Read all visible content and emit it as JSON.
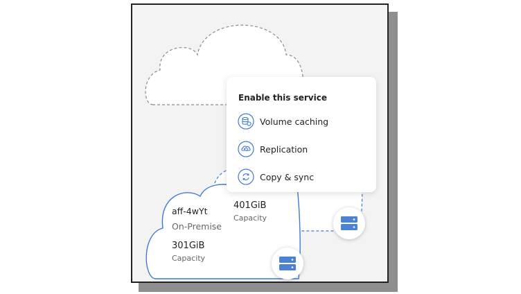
{
  "menu": {
    "title": "Enable this service",
    "items": [
      {
        "label": "Volume caching",
        "icon": "volume-caching-icon"
      },
      {
        "label": "Replication",
        "icon": "replication-icon"
      },
      {
        "label": "Copy & sync",
        "icon": "copy-sync-icon"
      }
    ]
  },
  "cloud_target": {
    "capacity_value": "401GiB",
    "capacity_label": "Capacity",
    "icon": "storage-server-icon"
  },
  "working_environment": {
    "name": "aff-4wYt",
    "status": "On-Premise",
    "capacity_value": "301GiB",
    "capacity_label": "Capacity",
    "icon": "storage-server-icon"
  },
  "colors": {
    "accent": "#3e7bd6",
    "icon_blue": "#4b82d4",
    "dashed_outline": "#8a8a8a"
  }
}
